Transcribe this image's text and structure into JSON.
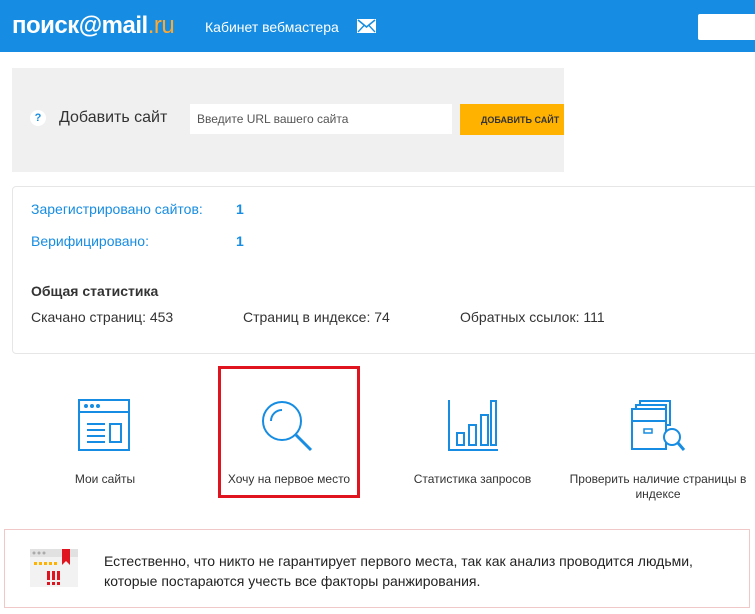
{
  "header": {
    "logo_main": "поиск@mail",
    "logo_suffix": ".ru",
    "cabinet_label": "Кабинет вебмастера",
    "mail_icon": "envelope-icon"
  },
  "add_site": {
    "help_icon": "?",
    "label": "Добавить сайт",
    "input_placeholder": "Введите URL вашего сайта",
    "input_value": "",
    "button_label": "Добавить сайт"
  },
  "stats": {
    "registered_label": "Зарегистрировано сайтов:",
    "registered_value": "1",
    "verified_label": "Верифицировано:",
    "verified_value": "1",
    "general_title": "Общая статистика",
    "downloaded": "Скачано страниц: 453",
    "indexed": "Страниц в индексе: 74",
    "backlinks": "Обратных ссылок: 111"
  },
  "tiles": [
    {
      "label": "Мои сайты",
      "icon": "browser-window-icon"
    },
    {
      "label": "Хочу на первое место",
      "icon": "magnifier-icon"
    },
    {
      "label": "Статистика запросов",
      "icon": "bar-chart-icon"
    },
    {
      "label": "Проверить наличие страницы в индексе",
      "icon": "documents-search-icon"
    }
  ],
  "notice": {
    "icon": "warning-window-icon",
    "text": "Естественно, что никто не гарантирует первого места, так как анализ проводится людьми, которые постараются учесть все факторы ранжирования."
  },
  "colors": {
    "brand_blue": "#168de2",
    "accent_orange": "#ffa930",
    "button_yellow": "#ffb300",
    "highlight_red": "#e0141e"
  }
}
